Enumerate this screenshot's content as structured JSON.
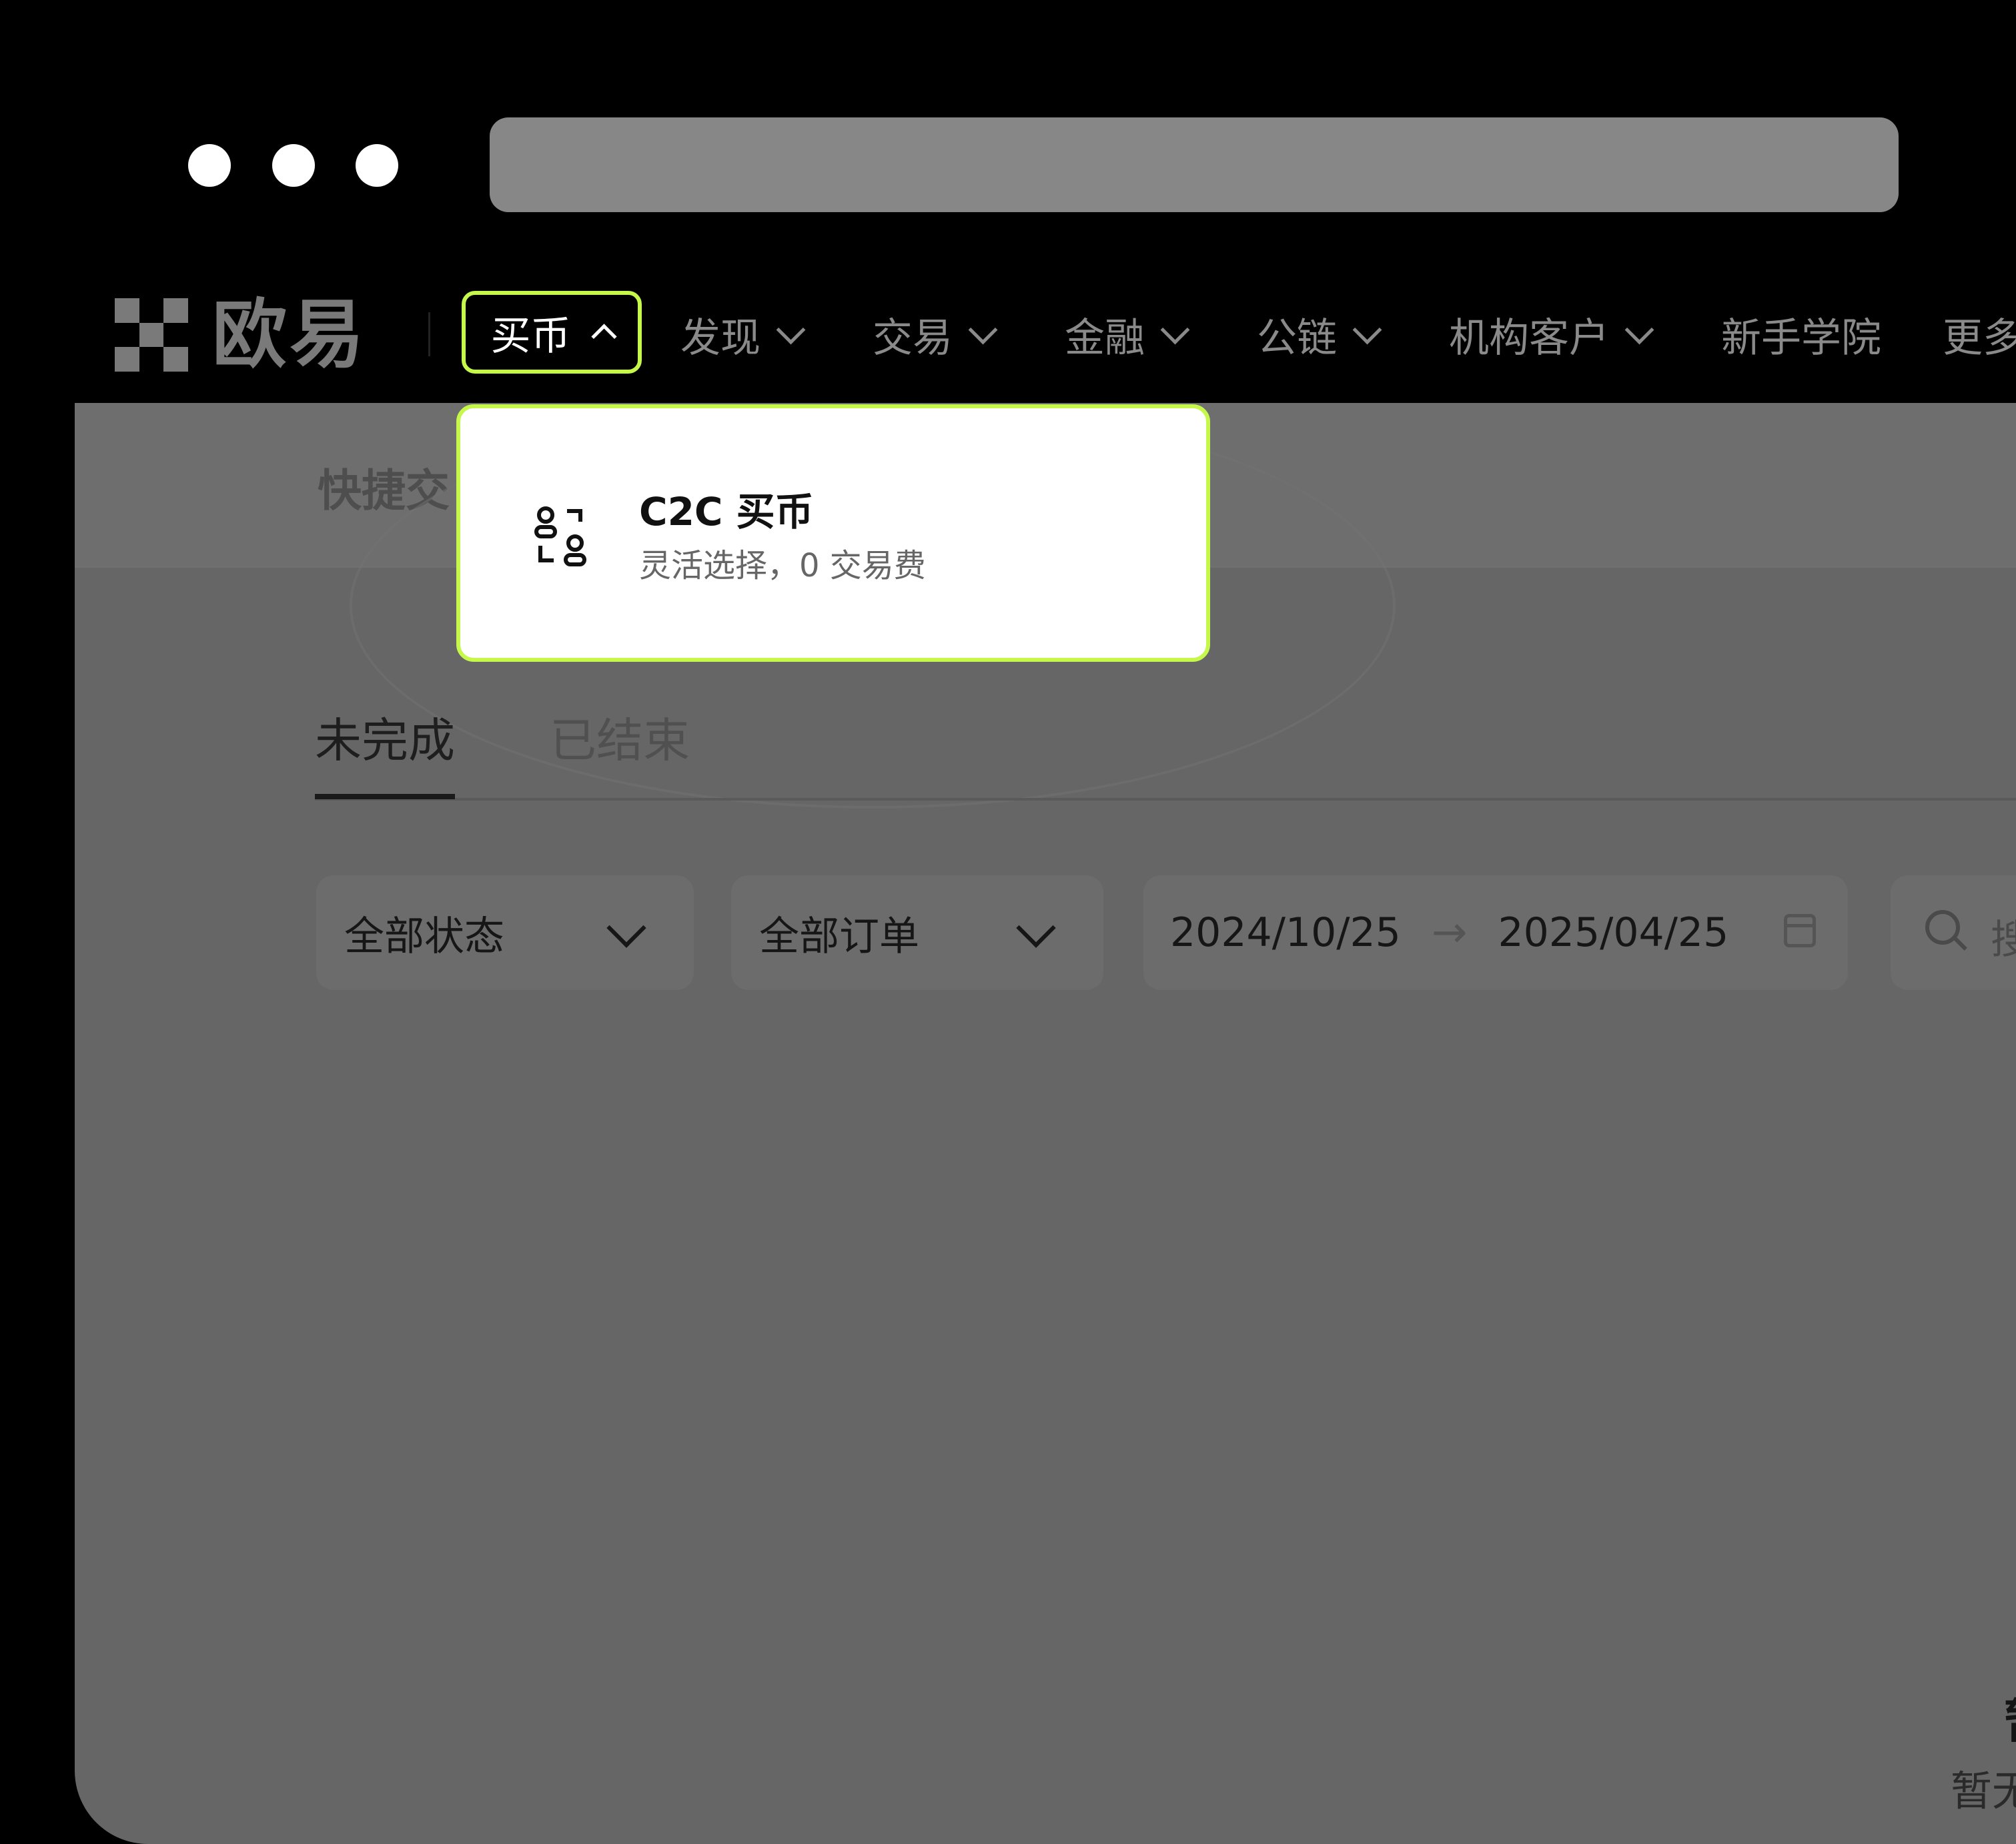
{
  "browser": {
    "window_dots": 3
  },
  "brand": {
    "name": "欧易"
  },
  "nav": {
    "active_label": "买币",
    "items": [
      {
        "label": "发现",
        "has_chevron": true
      },
      {
        "label": "交易",
        "has_chevron": true
      },
      {
        "label": "金融",
        "has_chevron": true
      },
      {
        "label": "公链",
        "has_chevron": true
      },
      {
        "label": "机构客户",
        "has_chevron": true
      },
      {
        "label": "新手学院",
        "has_chevron": false
      },
      {
        "label": "更多",
        "has_chevron": false
      }
    ]
  },
  "dropdown": {
    "item_title": "C2C 买币",
    "item_subtitle": "灵活选择，0 交易费",
    "item_icon": "c2c-users-icon"
  },
  "page": {
    "quick_title": "快捷交",
    "tabs": [
      {
        "label": "未完成",
        "active": true
      },
      {
        "label": "已结束",
        "active": false
      }
    ],
    "filters": {
      "status": "全部状态",
      "orders": "全部订单",
      "date_from": "2024/10/25",
      "date_arrow": "→",
      "date_to": "2025/04/25",
      "search_placeholder": "搜"
    },
    "empty": {
      "title": "暂",
      "text": "暂无"
    }
  },
  "colors": {
    "accent": "#c5f84a",
    "overlay": "#666666",
    "background": "#000000"
  }
}
